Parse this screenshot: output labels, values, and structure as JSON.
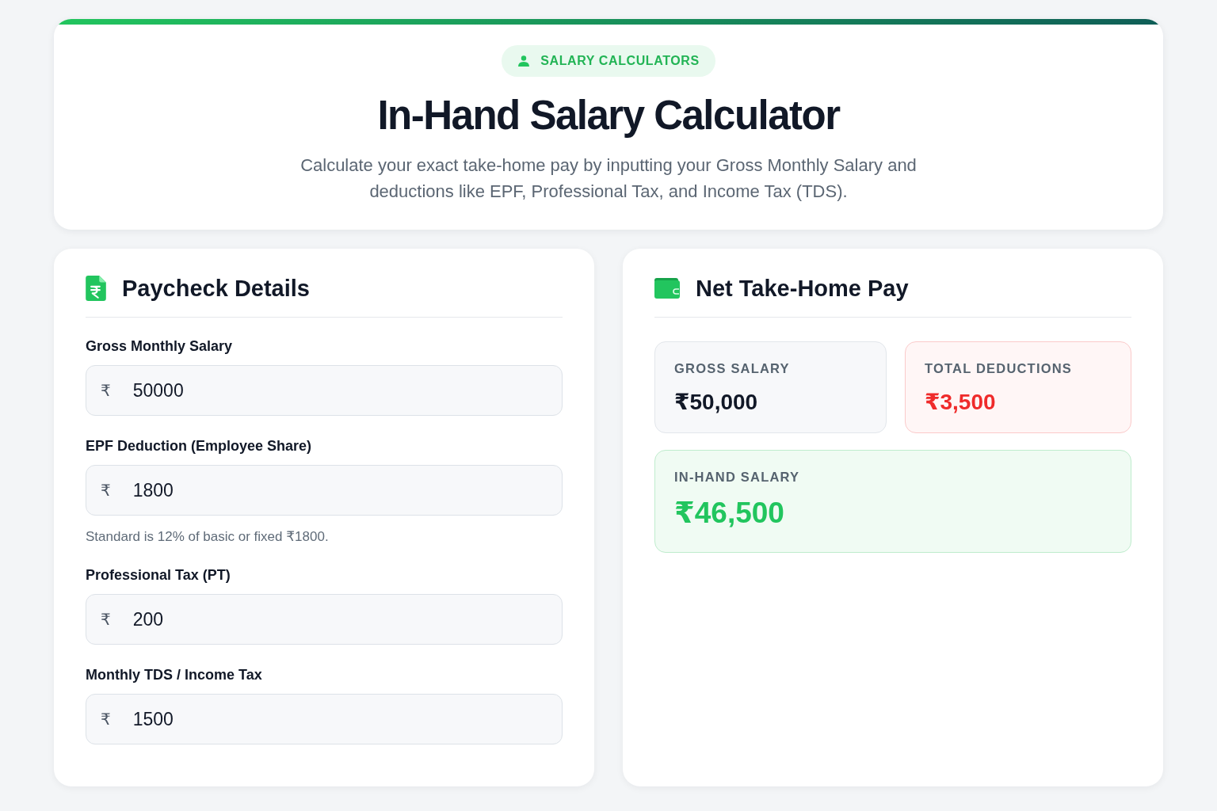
{
  "header": {
    "badge": "SALARY CALCULATORS",
    "title": "In-Hand Salary Calculator",
    "subtitle": "Calculate your exact take-home pay by inputting your Gross Monthly Salary and deductions like EPF, Professional Tax, and Income Tax (TDS)."
  },
  "inputs_panel": {
    "title": "Paycheck Details",
    "fields": [
      {
        "label": "Gross Monthly Salary",
        "prefix": "₹",
        "value": "50000"
      },
      {
        "label": "EPF Deduction (Employee Share)",
        "prefix": "₹",
        "value": "1800",
        "hint": "Standard is 12% of basic or fixed ₹1800."
      },
      {
        "label": "Professional Tax (PT)",
        "prefix": "₹",
        "value": "200"
      },
      {
        "label": "Monthly TDS / Income Tax",
        "prefix": "₹",
        "value": "1500"
      }
    ]
  },
  "results_panel": {
    "title": "Net Take-Home Pay",
    "cards": [
      {
        "kind": "neutral",
        "label": "GROSS SALARY",
        "value": "₹50,000"
      },
      {
        "kind": "negative",
        "label": "TOTAL DEDUCTIONS",
        "value": "₹3,500"
      },
      {
        "kind": "positive",
        "label": "IN-HAND SALARY",
        "value": "₹46,500"
      }
    ]
  }
}
